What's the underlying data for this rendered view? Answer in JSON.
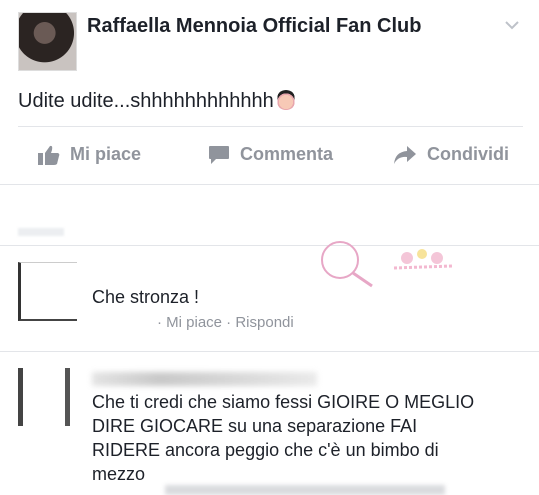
{
  "post": {
    "page_name": "Raffaella Mennoia Official Fan Club",
    "text": "Udite udite...shhhhhhhhhhhh"
  },
  "actions": {
    "like": "Mi piace",
    "comment": "Commenta",
    "share": "Condividi"
  },
  "comments": [
    {
      "text": "Che stronza !",
      "meta": "· Mi piace · Rispondi"
    },
    {
      "lines": [
        "Che ti credi che siamo fessi GIOIRE O MEGLIO",
        "DIRE GIOCARE su una separazione FAI",
        "RIDERE ancora peggio che c'è un bimbo di",
        "mezzo"
      ]
    }
  ],
  "colors": {
    "text": "#1d2129",
    "muted": "#90949c",
    "divider": "#e3e5e9"
  },
  "icons": [
    "chevron-down-icon",
    "like-thumb-icon",
    "comment-bubble-icon",
    "share-arrow-icon"
  ]
}
